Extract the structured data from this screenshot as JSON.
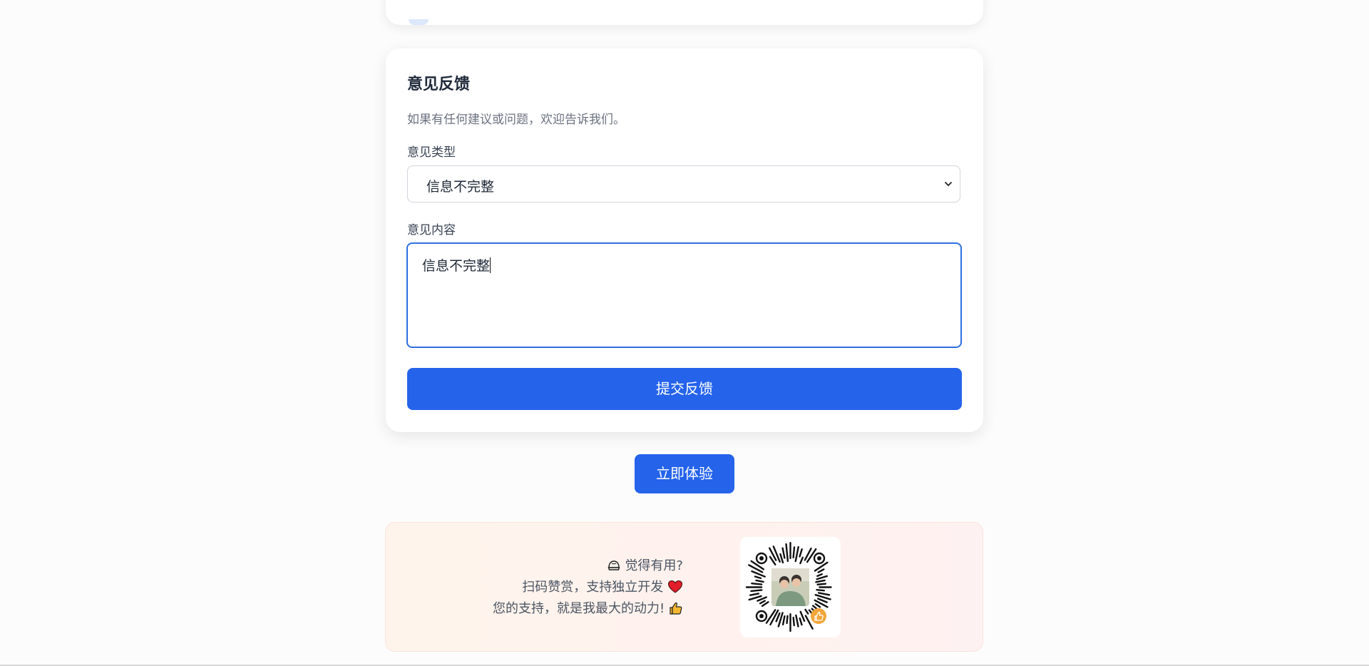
{
  "feedback": {
    "title": "意见反馈",
    "description": "如果有任何建议或问题，欢迎告诉我们。",
    "type_label": "意见类型",
    "type_selected": "信息不完整",
    "content_label": "意见内容",
    "content_value": "信息不完整",
    "submit_label": "提交反馈"
  },
  "try_button_label": "立即体验",
  "donate": {
    "line1": "觉得有用?",
    "line2": "扫码赞赏，支持独立开发",
    "line3": "您的支持，就是我最大的动力!",
    "line1_icon": "bun-icon",
    "line2_icon": "heart-icon",
    "line3_icon": "thumbs-up-icon"
  },
  "colors": {
    "primary": "#2563eb",
    "focus_border": "#2f6fe0",
    "heart": "#e11d2a",
    "thumb": "#f5b731"
  }
}
